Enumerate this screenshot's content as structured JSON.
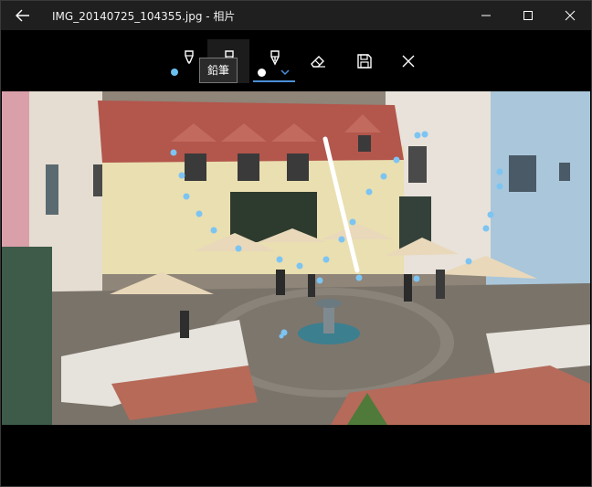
{
  "window": {
    "title": "IMG_20140725_104355.jpg - 相片"
  },
  "icons": {
    "back": "arrow-left-icon",
    "minimize": "minimize-icon",
    "maximize": "maximize-icon",
    "close": "close-icon"
  },
  "toolbar": {
    "tooltip": "鉛筆",
    "tools": [
      "ballpoint-pen",
      "pencil",
      "calligraphy-pen",
      "eraser",
      "save",
      "close"
    ],
    "colors": {
      "pen_color": "#6cc0f0",
      "pencil_color": "#ffffff",
      "calligraphy_color": "#ffffff",
      "active_underline": "#4a90d9"
    }
  },
  "photo": {
    "description_colors": {
      "sky_wall": "#e8e2d8",
      "roof": "#b0524a",
      "plaza": "#7b756c",
      "umbrella": "#e8d6b8",
      "blue_wall": "#a9c6d8",
      "pink_wall": "#d89aa6"
    },
    "ink": {
      "stroke_color": "#ffffff",
      "dot_color": "#7cc4f2"
    }
  }
}
